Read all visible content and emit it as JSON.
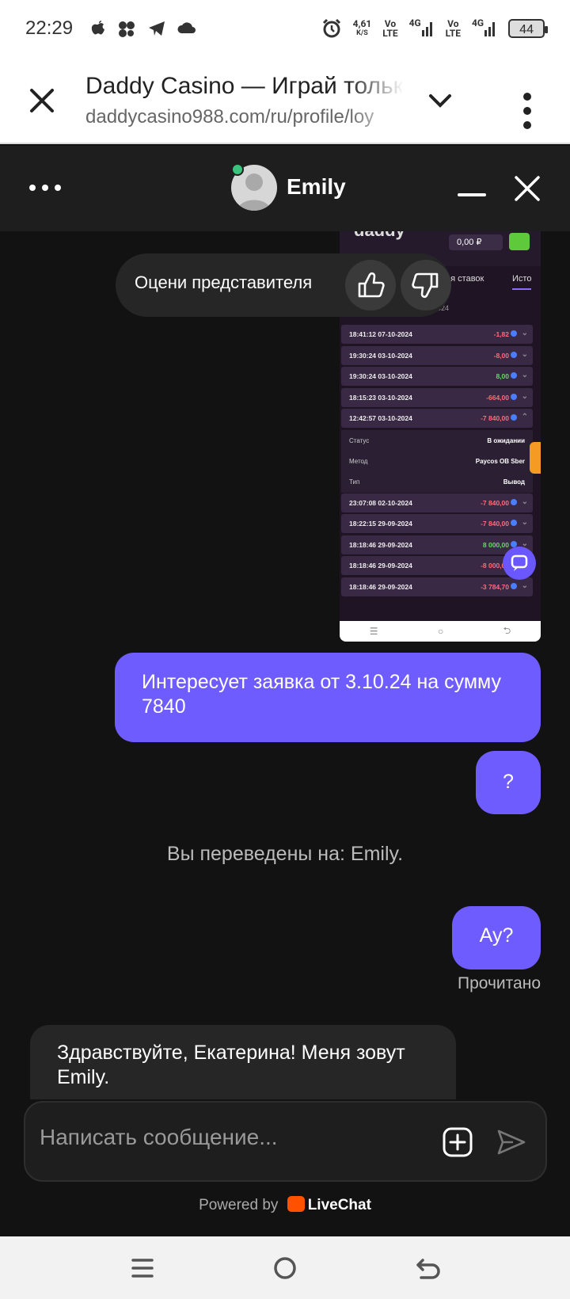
{
  "status_bar": {
    "time": "22:29",
    "net_speed_value": "4,61",
    "net_speed_unit": "K/S",
    "sim1_label_top": "Vo",
    "sim1_label_bottom": "LTE",
    "sim1_gen": "4G",
    "sim2_label_top": "Vo",
    "sim2_label_bottom": "LTE",
    "sim2_gen": "4G",
    "battery": "44"
  },
  "browser": {
    "title": "Daddy Casino — Играй тольк",
    "url": "daddycasino988.com/ru/profile/loy"
  },
  "chat_header": {
    "agent_name": "Emily"
  },
  "screenshot": {
    "logo": "daddy",
    "balance": "0,00 ₽",
    "tab_bets": "ия ставок",
    "tab_history": "Исто",
    "date_label": "2024",
    "rows_top": [
      {
        "time": "18:41:12 07-10-2024",
        "amount": "-1,82",
        "sign": "neg"
      },
      {
        "time": "19:30:24 03-10-2024",
        "amount": "-8,00",
        "sign": "neg"
      },
      {
        "time": "19:30:24 03-10-2024",
        "amount": "8,00",
        "sign": "pos"
      },
      {
        "time": "18:15:23 03-10-2024",
        "amount": "-664,00",
        "sign": "neg"
      },
      {
        "time": "12:42:57 03-10-2024",
        "amount": "-7 840,00",
        "sign": "neg"
      }
    ],
    "details": [
      {
        "key": "Статус",
        "value": "В ожидании"
      },
      {
        "key": "Метод",
        "value": "Paycos OB Sber"
      },
      {
        "key": "Тип",
        "value": "Вывод"
      }
    ],
    "rows_bottom": [
      {
        "time": "23:07:08 02-10-2024",
        "amount": "-7 840,00",
        "sign": "neg"
      },
      {
        "time": "18:22:15 29-09-2024",
        "amount": "-7 840,00",
        "sign": "neg"
      },
      {
        "time": "18:18:46 29-09-2024",
        "amount": "8 000,00",
        "sign": "pos"
      },
      {
        "time": "18:18:46 29-09-2024",
        "amount": "-8 000,00",
        "sign": "neg"
      },
      {
        "time": "18:18:46 29-09-2024",
        "amount": "-3 784,70",
        "sign": "neg"
      }
    ]
  },
  "rating": {
    "label": "Оцени представителя"
  },
  "messages": {
    "out_1": "Интересует заявка от 3.10.24 на сумму 7840",
    "out_2": "?",
    "system": "Вы переведены на: Emily.",
    "out_3": "Ау?",
    "read_status": "Прочитано",
    "in_1": "Здравствуйте, Екатерина! Меня зовут Emily."
  },
  "composer": {
    "placeholder": "Написать сообщение..."
  },
  "footer": {
    "powered_by": "Powered by",
    "brand": "LiveChat"
  },
  "colors": {
    "accent": "#6f5cff",
    "chat_bg": "#121212",
    "header_bg": "#1e1e1e",
    "online": "#3ac37c",
    "livechat_orange": "#ff5100"
  }
}
